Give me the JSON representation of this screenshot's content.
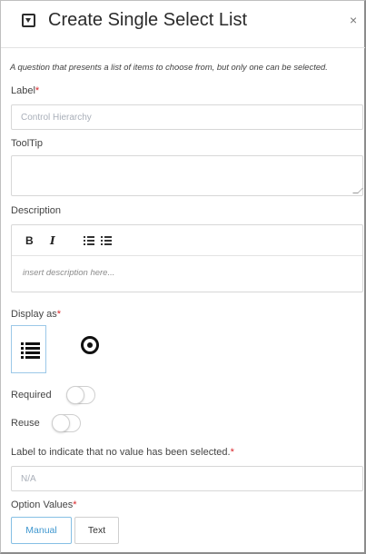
{
  "dialog": {
    "title": "Create Single Select List",
    "close_symbol": "×",
    "header_icon": "collapse-square-icon",
    "description": "A question that presents a list of items to choose from, but only one can be selected."
  },
  "form": {
    "label": {
      "text": "Label",
      "required_mark": "*",
      "placeholder": "Control Hierarchy",
      "value": ""
    },
    "tooltip": {
      "text": "ToolTip",
      "value": ""
    },
    "description": {
      "text": "Description",
      "toolbar": {
        "bold": "B",
        "italic": "I",
        "ordered_list_icon": "ordered-list-icon",
        "unordered_list_icon": "unordered-list-icon"
      },
      "placeholder": "insert description here..."
    },
    "display_as": {
      "text": "Display as",
      "required_mark": "*",
      "options": [
        {
          "icon": "list-icon",
          "selected": true
        },
        {
          "icon": "radio-icon",
          "selected": false
        }
      ]
    },
    "required": {
      "text": "Required",
      "on": false
    },
    "reuse": {
      "text": "Reuse",
      "on": false
    },
    "no_value_label": {
      "text": "Label to indicate that no value has been selected.",
      "required_mark": "*",
      "placeholder": "N/A",
      "value": ""
    },
    "option_values": {
      "text": "Option Values",
      "required_mark": "*",
      "buttons": {
        "manual": "Manual",
        "text": "Text"
      },
      "active": "Manual"
    }
  },
  "colors": {
    "accent": "#3f97cf",
    "required": "#d9252a",
    "selected_border": "#9bc8e8"
  }
}
